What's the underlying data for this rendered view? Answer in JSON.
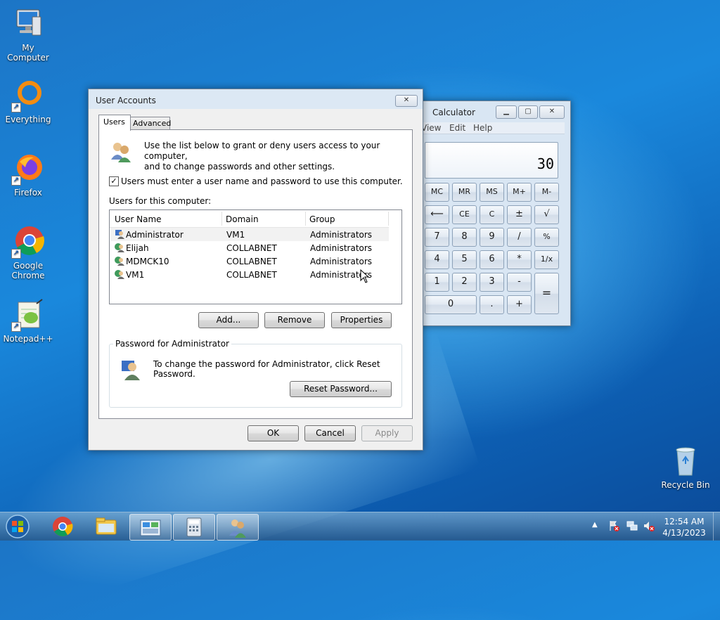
{
  "desktop": {
    "icons": [
      {
        "label": "My Computer"
      },
      {
        "label": "Everything"
      },
      {
        "label": "Firefox"
      },
      {
        "label": "Google Chrome"
      },
      {
        "label": "Notepad++"
      },
      {
        "label": "Recycle Bin"
      }
    ]
  },
  "calculator": {
    "title": "Calculator",
    "menu": [
      "View",
      "Edit",
      "Help"
    ],
    "display": "30",
    "buttons": {
      "mc": "MC",
      "mr": "MR",
      "ms": "MS",
      "mplus": "M+",
      "mminus": "M-",
      "back": "⟵",
      "ce": "CE",
      "c": "C",
      "pm": "±",
      "sqrt": "√",
      "n7": "7",
      "n8": "8",
      "n9": "9",
      "div": "/",
      "pct": "%",
      "n4": "4",
      "n5": "5",
      "n6": "6",
      "mul": "*",
      "inv": "1/x",
      "n1": "1",
      "n2": "2",
      "n3": "3",
      "sub": "-",
      "eq": "=",
      "n0": "0",
      "dot": ".",
      "add": "+"
    }
  },
  "dialog": {
    "title": "User Accounts",
    "close": "✕",
    "tabs": [
      "Users",
      "Advanced"
    ],
    "intro_line1": "Use the list below to grant or deny users access to your computer,",
    "intro_line2": "and to change passwords and other settings.",
    "checkbox_label": "Users must enter a user name and password to use this computer.",
    "checkbox_checked": true,
    "users_label": "Users for this computer:",
    "columns": [
      "User Name",
      "Domain",
      "Group"
    ],
    "users": [
      {
        "name": "Administrator",
        "domain": "VM1",
        "group": "Administrators"
      },
      {
        "name": "Elijah",
        "domain": "COLLABNET",
        "group": "Administrators"
      },
      {
        "name": "MDMCK10",
        "domain": "COLLABNET",
        "group": "Administrators"
      },
      {
        "name": "VM1",
        "domain": "COLLABNET",
        "group": "Administrators"
      }
    ],
    "add": "Add...",
    "remove": "Remove",
    "properties": "Properties",
    "password_group": "Password for Administrator",
    "password_text": "To change the password for Administrator, click Reset Password.",
    "reset_password": "Reset Password...",
    "ok": "OK",
    "cancel": "Cancel",
    "apply": "Apply"
  },
  "taskbar": {
    "time": "12:54 AM",
    "date": "4/13/2023"
  }
}
